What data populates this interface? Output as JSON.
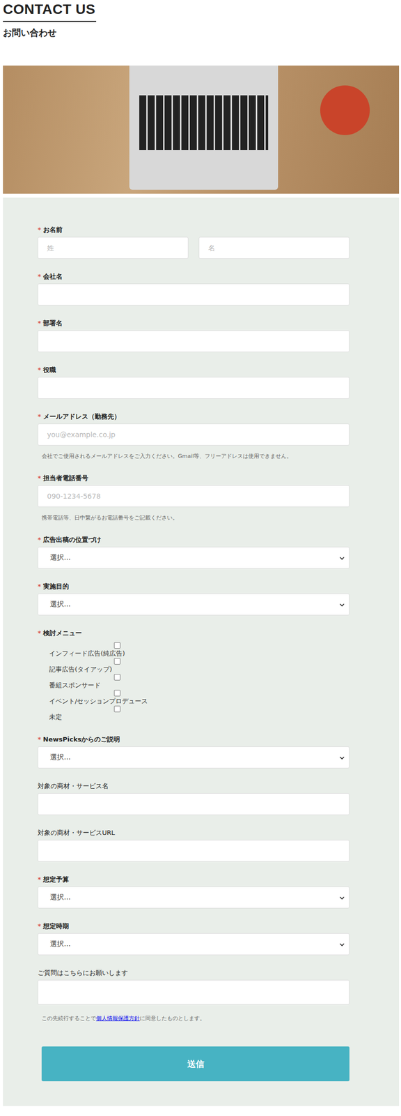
{
  "header": {
    "title": "CONTACT US",
    "subtitle": "お問い合わせ"
  },
  "form": {
    "fields": [
      {
        "kind": "name",
        "label": "お名前",
        "mark": "*",
        "inputs": [
          {
            "placeholder": "姓"
          },
          {
            "placeholder": "名"
          }
        ]
      },
      {
        "kind": "text",
        "label": "会社名",
        "mark": "*"
      },
      {
        "kind": "text",
        "label": "部署名",
        "mark": "*"
      },
      {
        "kind": "text",
        "label": "役職",
        "mark": "*"
      },
      {
        "kind": "text",
        "label": "メールアドレス（勤務先）",
        "mark": "*",
        "placeholder": "you@example.co.jp",
        "help": "会社でご使用されるメールアドレスをご入力ください。Gmail等、フリーアドレスは使用できません。"
      },
      {
        "kind": "text",
        "label": "担当者電話番号",
        "mark": "*",
        "placeholder": "090-1234-5678",
        "help": "携帯電話等、日中繋がるお電話番号をご記載ください。"
      },
      {
        "kind": "select",
        "label": "広告出稿の位置づけ",
        "mark": "*",
        "value": "選択..."
      },
      {
        "kind": "select",
        "label": "実施目的",
        "mark": "*",
        "value": "選択..."
      },
      {
        "kind": "checkboxes",
        "label": "検討メニュー",
        "mark": "*",
        "options": [
          {
            "label": "インフィード広告(純広告)",
            "checked": false
          },
          {
            "label": "記事広告(タイアップ)",
            "checked": false
          },
          {
            "label": "番組スポンサード",
            "checked": false
          },
          {
            "label": "イベント/セッションプロデュース",
            "checked": false
          },
          {
            "label": "未定",
            "checked": false
          }
        ]
      },
      {
        "kind": "select",
        "label": "NewsPicksからのご説明",
        "mark": "*",
        "value": "選択..."
      },
      {
        "kind": "text",
        "label": "対象の商材・サービス名"
      },
      {
        "kind": "text",
        "label": "対象の商材・サービスURL"
      },
      {
        "kind": "select",
        "label": "想定予算",
        "mark": "*",
        "value": "選択..."
      },
      {
        "kind": "select",
        "label": "想定時期",
        "mark": "*",
        "value": "選択..."
      },
      {
        "kind": "textarea",
        "label": "ご質問はこちらにお願いします"
      }
    ],
    "consent": {
      "before": "この先続行することで",
      "link": "個人情報保護方針",
      "after": "に同意したものとします。"
    },
    "submit": "送信"
  }
}
